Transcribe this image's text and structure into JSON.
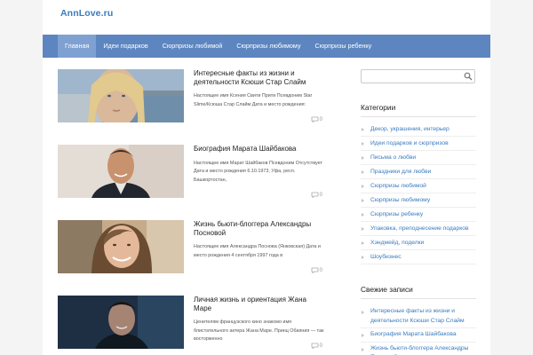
{
  "site": {
    "title": "AnnLove.ru"
  },
  "nav": {
    "items": [
      {
        "label": "Главная"
      },
      {
        "label": "Идеи подарков"
      },
      {
        "label": "Сюрпризы любимой"
      },
      {
        "label": "Сюрпризы любимому"
      },
      {
        "label": "Сюрпризы ребенку"
      }
    ]
  },
  "posts": [
    {
      "title": "Интересные факты из жизни и деятельности Ксюши Стар Слайм",
      "excerpt": "Настоящее имя Ксения Свити Прити Псевдоним Star Slime/Ксюша Стар Слайм Дата и место рождения:",
      "comments": "0"
    },
    {
      "title": "Биография Марата Шайбакова",
      "excerpt": "Настоящее имя Марат Шайбаков Псевдоним Отсутствует Дата и место рождения 6.10.1973, Уфа, респ. Башкортостан,",
      "comments": "0"
    },
    {
      "title": "Жизнь бьюти-блоггера Александры Посновой",
      "excerpt": "Настоящее имя Александра Поснова (Янковская) Дата и место рождения 4 сентября 1997 года в",
      "comments": "0"
    },
    {
      "title": "Личная жизнь и ориентация Жана Маре",
      "excerpt": "Ценителям французского кино знакомо имя блистательного актера Жана Маре. Принц Обаяния — так восторженно",
      "comments": "0"
    }
  ],
  "sidebar": {
    "search": {
      "value": "",
      "placeholder": ""
    },
    "categories_title": "Категории",
    "categories": [
      {
        "label": "Декор, украшения, интерьер"
      },
      {
        "label": "Идеи подарков и сюрпризов"
      },
      {
        "label": "Письма о любви"
      },
      {
        "label": "Праздники для любви"
      },
      {
        "label": "Сюрпризы любимой"
      },
      {
        "label": "Сюрпризы любимому"
      },
      {
        "label": "Сюрпризы ребенку"
      },
      {
        "label": "Упаковка, преподнесение подарков"
      },
      {
        "label": "Хэндмейд, поделки"
      },
      {
        "label": "Шоубизнес"
      }
    ],
    "recent_title": "Свежие записи",
    "recent": [
      {
        "label": "Интересные факты из жизни и деятельности Ксюши Стар Слайм"
      },
      {
        "label": "Биография Марата Шайбакова"
      },
      {
        "label": "Жизнь бьюти-блоггера Александры Посновой"
      }
    ]
  },
  "icons": {
    "search": "search-icon",
    "comment": "speech-bubble-icon",
    "bullet": "triangle-right-icon"
  },
  "colors": {
    "nav_background": "#5d86c0",
    "nav_active": "#7ea1d2",
    "link": "#3a7bbf",
    "site_title": "#3a7bbf"
  }
}
